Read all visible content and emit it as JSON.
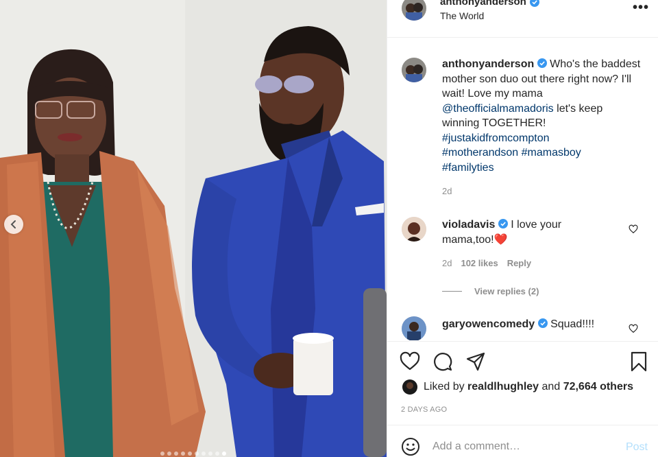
{
  "colors": {
    "accent_blue": "#0095f6",
    "link": "#00376b",
    "muted": "#8e8e8e",
    "heart_red": "#ed4956",
    "post_disabled": "#b2dffc"
  },
  "header": {
    "username": "anthonyanderson",
    "location": "The World",
    "verified_icon": "verified-badge-icon",
    "more_label": "•••"
  },
  "caption": {
    "username": "anthonyanderson",
    "text_1": "Who's the baddest mother son duo out there right now? I'll wait! Love my mama",
    "mention": "@theofficialmamadoris",
    "text_2": "let's keep winning TOGETHER!",
    "tag_1": "#justakidfromcompton",
    "tag_2": "#motherandson",
    "tag_3": "#mamasboy",
    "tag_4": "#familyties",
    "time": "2d"
  },
  "comments": [
    {
      "username": "violadavis",
      "text": "I love your mama,too!",
      "emoji": "❤️",
      "time": "2d",
      "likes": "102 likes",
      "reply_label": "Reply"
    },
    {
      "username": "garyowencomedy",
      "text": "Squad!!!!"
    }
  ],
  "view_replies": "View replies (2)",
  "likes": {
    "prefix": "Liked by",
    "user": "realdlhughley",
    "and": "and",
    "count": "72,664 others"
  },
  "post_age": "2 DAYS AGO",
  "add_comment": {
    "placeholder": "Add a comment…",
    "post_label": "Post"
  },
  "carousel": {
    "total": 10,
    "active_index": 9
  }
}
